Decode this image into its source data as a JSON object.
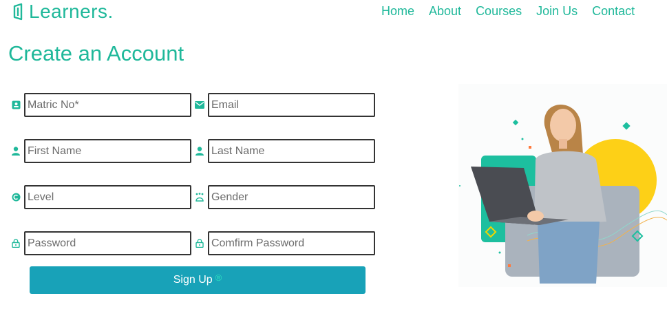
{
  "brand": {
    "name": "Learners."
  },
  "nav": [
    {
      "label": "Home"
    },
    {
      "label": "About"
    },
    {
      "label": "Courses"
    },
    {
      "label": "Join Us"
    },
    {
      "label": "Contact"
    }
  ],
  "page_title": "Create an Account",
  "form": {
    "matric": {
      "placeholder": "Matric No*",
      "icon": "id-card-icon"
    },
    "email": {
      "placeholder": "Email",
      "icon": "envelope-icon"
    },
    "first_name": {
      "placeholder": "First Name",
      "icon": "user-icon"
    },
    "last_name": {
      "placeholder": "Last Name",
      "icon": "user-icon"
    },
    "level": {
      "placeholder": "Level",
      "icon": "level-icon"
    },
    "gender": {
      "placeholder": "Gender",
      "icon": "gender-icon"
    },
    "password": {
      "placeholder": "Password",
      "icon": "lock-icon"
    },
    "confirm_password": {
      "placeholder": "Comfirm Password",
      "icon": "lock-icon"
    }
  },
  "signup": {
    "label": "Sign Up",
    "mark": "®"
  },
  "colors": {
    "accent": "#1fb89a",
    "button": "#18a2b8",
    "hero_circle": "#fdd017",
    "hero_card": "#1dbf9f"
  }
}
